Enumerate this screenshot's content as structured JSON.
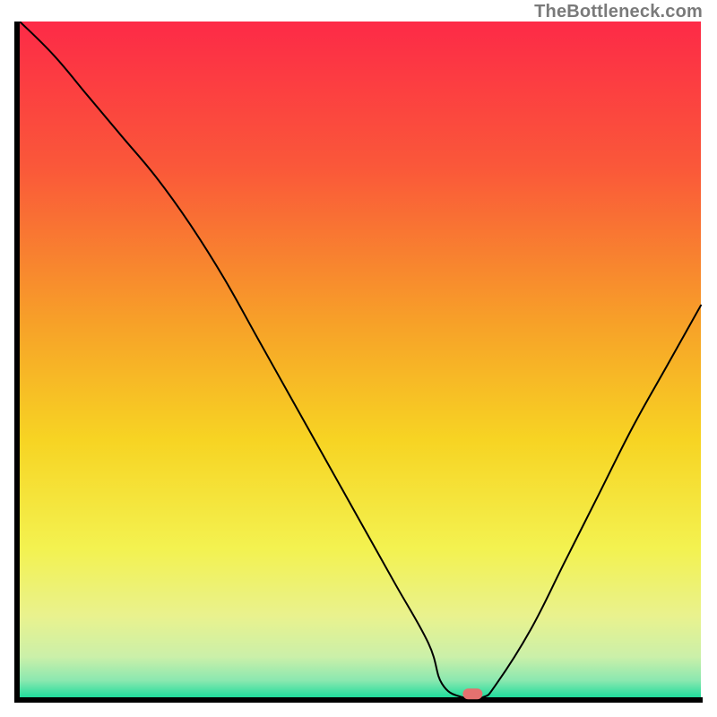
{
  "attribution": "TheBottleneck.com",
  "chart_data": {
    "type": "line",
    "title": "",
    "xlabel": "",
    "ylabel": "",
    "xlim": [
      0,
      100
    ],
    "ylim": [
      0,
      100
    ],
    "grid": false,
    "legend": false,
    "x": [
      0,
      5,
      10,
      15,
      20,
      25,
      30,
      35,
      40,
      45,
      50,
      55,
      60,
      62,
      65,
      68,
      70,
      75,
      80,
      85,
      90,
      95,
      100
    ],
    "values": [
      100,
      95,
      89,
      83,
      77,
      70,
      62,
      53,
      44,
      35,
      26,
      17,
      8,
      2,
      0,
      0,
      2,
      10,
      20,
      30,
      40,
      49,
      58
    ],
    "annotations": [
      {
        "kind": "marker",
        "x": 66.5,
        "y": 0.5,
        "shape": "rounded-rect",
        "color": "#e4716f"
      }
    ],
    "gradient_background": {
      "stops": [
        {
          "offset": 0.0,
          "color": "#fd2a47"
        },
        {
          "offset": 0.22,
          "color": "#fa5939"
        },
        {
          "offset": 0.45,
          "color": "#f7a228"
        },
        {
          "offset": 0.62,
          "color": "#f7d423"
        },
        {
          "offset": 0.78,
          "color": "#f3f250"
        },
        {
          "offset": 0.88,
          "color": "#e9f28e"
        },
        {
          "offset": 0.94,
          "color": "#cbf0a9"
        },
        {
          "offset": 0.975,
          "color": "#8be8b0"
        },
        {
          "offset": 1.0,
          "color": "#20dc9c"
        }
      ]
    },
    "axes_color": "#000000",
    "line_color": "#000000",
    "line_width": 2
  }
}
